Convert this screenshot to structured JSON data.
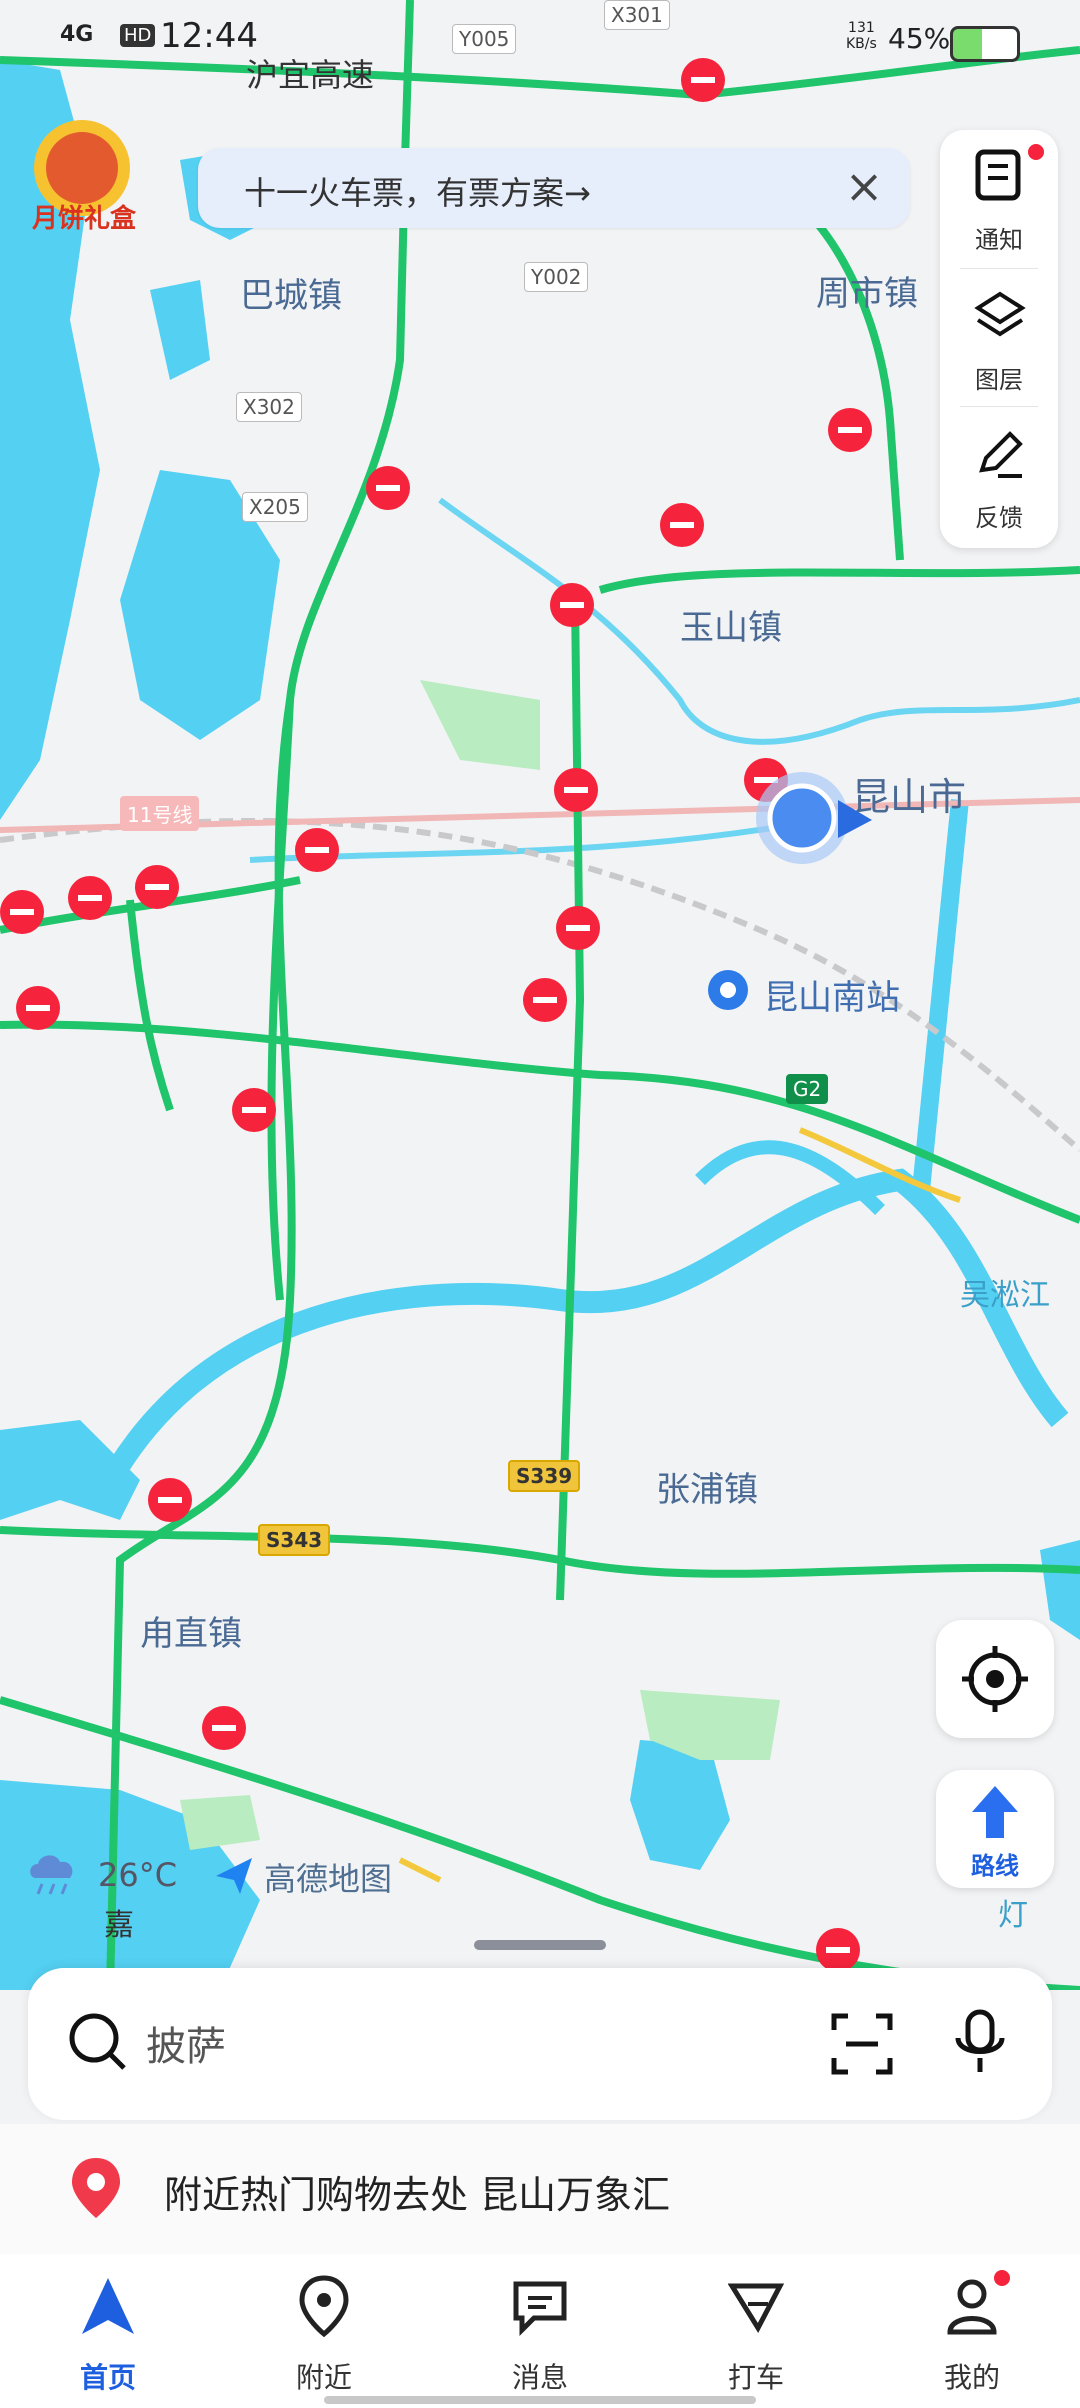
{
  "status_bar": {
    "network": "4G",
    "hd": "HD",
    "time": "12:44",
    "speed_value": "131",
    "speed_unit": "KB/s",
    "battery": "45%"
  },
  "promo": {
    "label": "月饼礼盒"
  },
  "banner": {
    "text": "十一火车票，有票方案→"
  },
  "side_panel": {
    "items": [
      {
        "label": "通知",
        "icon": "notice-icon"
      },
      {
        "label": "图层",
        "icon": "layers-icon"
      },
      {
        "label": "反馈",
        "icon": "feedback-icon"
      }
    ]
  },
  "map": {
    "place_labels": [
      "巴城镇",
      "周市镇",
      "玉山镇",
      "昆山市",
      "昆山南站",
      "张浦镇",
      "甪直镇",
      "沪宜高速",
      "吴淞江",
      "灯",
      "嘉"
    ],
    "road_labels": [
      "Y005",
      "X301",
      "Y002",
      "X302",
      "X205",
      "11号线",
      "G2",
      "S339",
      "S343"
    ]
  },
  "weather": {
    "temp": "26°C",
    "icon": "rain-cloud-icon"
  },
  "logo": {
    "name": "高德地图"
  },
  "route_button": {
    "label": "路线"
  },
  "search": {
    "placeholder": "披萨"
  },
  "hot_place": {
    "text": "附近热门购物去处 昆山万象汇"
  },
  "tabs": [
    {
      "label": "首页",
      "icon": "navigation-arrow-icon",
      "active": true
    },
    {
      "label": "附近",
      "icon": "location-pin-icon",
      "active": false
    },
    {
      "label": "消息",
      "icon": "message-icon",
      "active": false
    },
    {
      "label": "打车",
      "icon": "taxi-icon",
      "active": false
    },
    {
      "label": "我的",
      "icon": "user-icon",
      "active": false
    }
  ],
  "colors": {
    "accent": "#1e5fe0",
    "road_green": "#1fc46b",
    "water": "#54d0f2",
    "alert_red": "#f5233b"
  }
}
